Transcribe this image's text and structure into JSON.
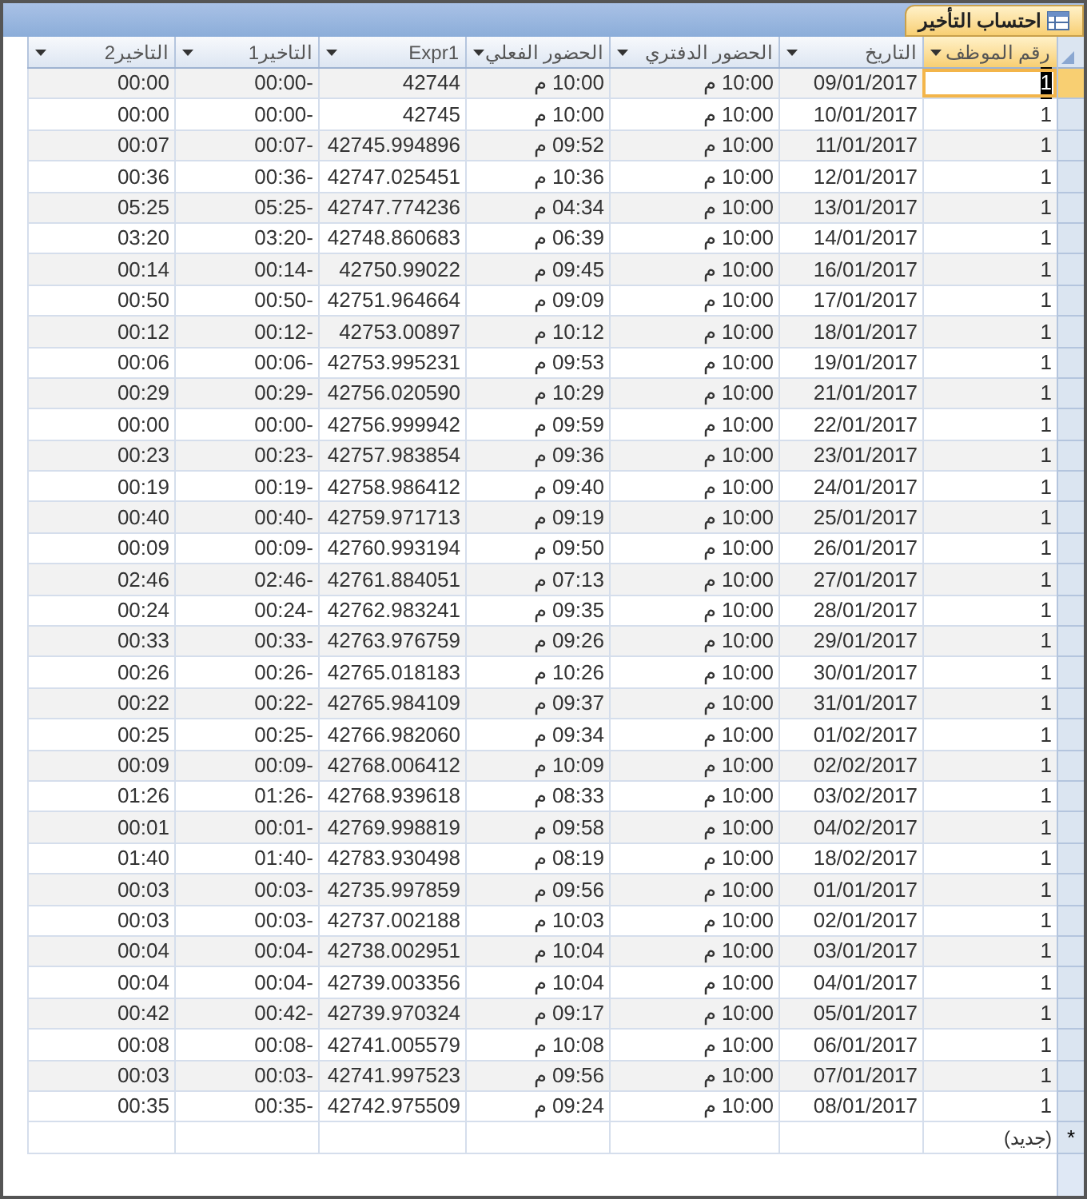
{
  "document_tab": {
    "title": "احتساب التأخير",
    "selected": true
  },
  "columns": [
    {
      "label": "رقم الموظف",
      "selected": true
    },
    {
      "label": "التاريخ",
      "selected": false
    },
    {
      "label": "الحضور الدفتري",
      "selected": false
    },
    {
      "label": "الحضور الفعلي",
      "selected": false
    },
    {
      "label": "Expr1",
      "selected": false
    },
    {
      "label": "التاخير1",
      "selected": false
    },
    {
      "label": "التاخير2",
      "selected": false
    }
  ],
  "rows": [
    {
      "selected": true,
      "cells": [
        "1",
        "09/01/2017",
        "10:00 م",
        "10:00 م",
        "42744",
        "00:00-",
        "00:00"
      ]
    },
    {
      "selected": false,
      "cells": [
        "1",
        "10/01/2017",
        "10:00 م",
        "10:00 م",
        "42745",
        "00:00-",
        "00:00"
      ]
    },
    {
      "selected": false,
      "cells": [
        "1",
        "11/01/2017",
        "10:00 م",
        "09:52 م",
        "42745.994896",
        "00:07-",
        "00:07"
      ]
    },
    {
      "selected": false,
      "cells": [
        "1",
        "12/01/2017",
        "10:00 م",
        "10:36 م",
        "42747.025451",
        "00:36-",
        "00:36"
      ]
    },
    {
      "selected": false,
      "cells": [
        "1",
        "13/01/2017",
        "10:00 م",
        "04:34 م",
        "42747.774236",
        "05:25-",
        "05:25"
      ]
    },
    {
      "selected": false,
      "cells": [
        "1",
        "14/01/2017",
        "10:00 م",
        "06:39 م",
        "42748.860683",
        "03:20-",
        "03:20"
      ]
    },
    {
      "selected": false,
      "cells": [
        "1",
        "16/01/2017",
        "10:00 م",
        "09:45 م",
        "42750.99022",
        "00:14-",
        "00:14"
      ]
    },
    {
      "selected": false,
      "cells": [
        "1",
        "17/01/2017",
        "10:00 م",
        "09:09 م",
        "42751.964664",
        "00:50-",
        "00:50"
      ]
    },
    {
      "selected": false,
      "cells": [
        "1",
        "18/01/2017",
        "10:00 م",
        "10:12 م",
        "42753.00897",
        "00:12-",
        "00:12"
      ]
    },
    {
      "selected": false,
      "cells": [
        "1",
        "19/01/2017",
        "10:00 م",
        "09:53 م",
        "42753.995231",
        "00:06-",
        "00:06"
      ]
    },
    {
      "selected": false,
      "cells": [
        "1",
        "21/01/2017",
        "10:00 م",
        "10:29 م",
        "42756.020590",
        "00:29-",
        "00:29"
      ]
    },
    {
      "selected": false,
      "cells": [
        "1",
        "22/01/2017",
        "10:00 م",
        "09:59 م",
        "42756.999942",
        "00:00-",
        "00:00"
      ]
    },
    {
      "selected": false,
      "cells": [
        "1",
        "23/01/2017",
        "10:00 م",
        "09:36 م",
        "42757.983854",
        "00:23-",
        "00:23"
      ]
    },
    {
      "selected": false,
      "cells": [
        "1",
        "24/01/2017",
        "10:00 م",
        "09:40 م",
        "42758.986412",
        "00:19-",
        "00:19"
      ]
    },
    {
      "selected": false,
      "cells": [
        "1",
        "25/01/2017",
        "10:00 م",
        "09:19 م",
        "42759.971713",
        "00:40-",
        "00:40"
      ]
    },
    {
      "selected": false,
      "cells": [
        "1",
        "26/01/2017",
        "10:00 م",
        "09:50 م",
        "42760.993194",
        "00:09-",
        "00:09"
      ]
    },
    {
      "selected": false,
      "cells": [
        "1",
        "27/01/2017",
        "10:00 م",
        "07:13 م",
        "42761.884051",
        "02:46-",
        "02:46"
      ]
    },
    {
      "selected": false,
      "cells": [
        "1",
        "28/01/2017",
        "10:00 م",
        "09:35 م",
        "42762.983241",
        "00:24-",
        "00:24"
      ]
    },
    {
      "selected": false,
      "cells": [
        "1",
        "29/01/2017",
        "10:00 م",
        "09:26 م",
        "42763.976759",
        "00:33-",
        "00:33"
      ]
    },
    {
      "selected": false,
      "cells": [
        "1",
        "30/01/2017",
        "10:00 م",
        "10:26 م",
        "42765.018183",
        "00:26-",
        "00:26"
      ]
    },
    {
      "selected": false,
      "cells": [
        "1",
        "31/01/2017",
        "10:00 م",
        "09:37 م",
        "42765.984109",
        "00:22-",
        "00:22"
      ]
    },
    {
      "selected": false,
      "cells": [
        "1",
        "01/02/2017",
        "10:00 م",
        "09:34 م",
        "42766.982060",
        "00:25-",
        "00:25"
      ]
    },
    {
      "selected": false,
      "cells": [
        "1",
        "02/02/2017",
        "10:00 م",
        "10:09 م",
        "42768.006412",
        "00:09-",
        "00:09"
      ]
    },
    {
      "selected": false,
      "cells": [
        "1",
        "03/02/2017",
        "10:00 م",
        "08:33 م",
        "42768.939618",
        "01:26-",
        "01:26"
      ]
    },
    {
      "selected": false,
      "cells": [
        "1",
        "04/02/2017",
        "10:00 م",
        "09:58 م",
        "42769.998819",
        "00:01-",
        "00:01"
      ]
    },
    {
      "selected": false,
      "cells": [
        "1",
        "18/02/2017",
        "10:00 م",
        "08:19 م",
        "42783.930498",
        "01:40-",
        "01:40"
      ]
    },
    {
      "selected": false,
      "cells": [
        "1",
        "01/01/2017",
        "10:00 م",
        "09:56 م",
        "42735.997859",
        "00:03-",
        "00:03"
      ]
    },
    {
      "selected": false,
      "cells": [
        "1",
        "02/01/2017",
        "10:00 م",
        "10:03 م",
        "42737.002188",
        "00:03-",
        "00:03"
      ]
    },
    {
      "selected": false,
      "cells": [
        "1",
        "03/01/2017",
        "10:00 م",
        "10:04 م",
        "42738.002951",
        "00:04-",
        "00:04"
      ]
    },
    {
      "selected": false,
      "cells": [
        "1",
        "04/01/2017",
        "10:00 م",
        "10:04 م",
        "42739.003356",
        "00:04-",
        "00:04"
      ]
    },
    {
      "selected": false,
      "cells": [
        "1",
        "05/01/2017",
        "10:00 م",
        "09:17 م",
        "42739.970324",
        "00:42-",
        "00:42"
      ]
    },
    {
      "selected": false,
      "cells": [
        "1",
        "06/01/2017",
        "10:00 م",
        "10:08 م",
        "42741.005579",
        "00:08-",
        "00:08"
      ]
    },
    {
      "selected": false,
      "cells": [
        "1",
        "07/01/2017",
        "10:00 م",
        "09:56 م",
        "42741.997523",
        "00:03-",
        "00:03"
      ]
    },
    {
      "selected": false,
      "cells": [
        "1",
        "08/01/2017",
        "10:00 م",
        "09:24 م",
        "42742.975509",
        "00:35-",
        "00:35"
      ]
    }
  ],
  "new_row": {
    "marker": "*",
    "label": "(جديد)"
  }
}
